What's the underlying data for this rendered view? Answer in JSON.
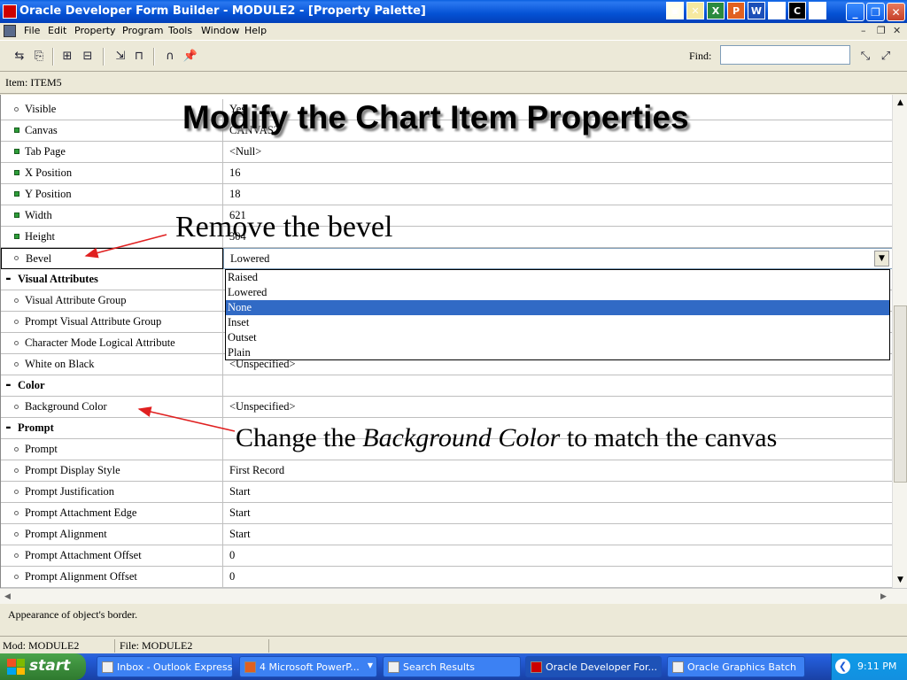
{
  "window": {
    "title": "Oracle Developer Form Builder - MODULE2 - [Property Palette]",
    "min_glyph": "_",
    "max_glyph": "❐",
    "close_glyph": "✕"
  },
  "menubar": {
    "items": [
      "File",
      "Edit",
      "Property",
      "Program",
      "Tools",
      "Window",
      "Help"
    ],
    "mdi": [
      "–",
      "❐",
      "✕"
    ]
  },
  "toolbar": {
    "find_label": "Find:",
    "find_value": ""
  },
  "context": {
    "item_label": "Item: ITEM5"
  },
  "properties": [
    {
      "name": "Visible",
      "value": "Yes",
      "marker": "default"
    },
    {
      "name": "Canvas",
      "value": "CANVAS2",
      "marker": "modified"
    },
    {
      "name": "Tab Page",
      "value": "<Null>",
      "marker": "modified"
    },
    {
      "name": "X Position",
      "value": "16",
      "marker": "modified"
    },
    {
      "name": "Y Position",
      "value": "18",
      "marker": "modified"
    },
    {
      "name": "Width",
      "value": "621",
      "marker": "modified"
    },
    {
      "name": "Height",
      "value": "304",
      "marker": "modified"
    },
    {
      "name": "Bevel",
      "value": "Lowered",
      "marker": "default"
    },
    {
      "name": "Visual Attributes",
      "value": "",
      "marker": "section"
    },
    {
      "name": "Visual Attribute Group",
      "value": "",
      "marker": "default"
    },
    {
      "name": "Prompt Visual Attribute Group",
      "value": "",
      "marker": "default"
    },
    {
      "name": "Character Mode Logical Attribute",
      "value": "",
      "marker": "default"
    },
    {
      "name": "White on Black",
      "value": "<Unspecified>",
      "marker": "default"
    },
    {
      "name": "Color",
      "value": "",
      "marker": "section"
    },
    {
      "name": "Background Color",
      "value": "<Unspecified>",
      "marker": "default"
    },
    {
      "name": "Prompt",
      "value": "",
      "marker": "section"
    },
    {
      "name": "Prompt",
      "value": "",
      "marker": "default"
    },
    {
      "name": "Prompt Display Style",
      "value": "First Record",
      "marker": "default"
    },
    {
      "name": "Prompt Justification",
      "value": "Start",
      "marker": "default"
    },
    {
      "name": "Prompt Attachment Edge",
      "value": "Start",
      "marker": "default"
    },
    {
      "name": "Prompt Alignment",
      "value": "Start",
      "marker": "default"
    },
    {
      "name": "Prompt Attachment Offset",
      "value": "0",
      "marker": "default"
    },
    {
      "name": "Prompt Alignment Offset",
      "value": "0",
      "marker": "default"
    }
  ],
  "bevel_dropdown": {
    "options": [
      "Raised",
      "Lowered",
      "None",
      "Inset",
      "Outset",
      "Plain"
    ],
    "highlighted": "None",
    "arrow": "▼"
  },
  "scroll": {
    "up": "▲",
    "down": "▼",
    "left": "◀",
    "right": "▶"
  },
  "hint": "Appearance of object's border.",
  "status": {
    "mod": "Mod: MODULE2",
    "file": "File: MODULE2"
  },
  "overlay": {
    "title": "Modify the Chart Item Properties",
    "note_bevel": "Remove the bevel",
    "note_color_pre": "Change the ",
    "note_color_em": "Background Color",
    "note_color_post": " to match the canvas"
  },
  "taskbar": {
    "start": "start",
    "tasks": [
      {
        "label": "Inbox - Outlook Express",
        "active": false
      },
      {
        "label": "4 Microsoft PowerP...",
        "active": false
      },
      {
        "label": "Search Results",
        "active": false
      },
      {
        "label": "Oracle Developer For...",
        "active": true
      },
      {
        "label": "Oracle Graphics Batch",
        "active": false
      }
    ],
    "clock": "9:11 PM",
    "tray_arrow": "❮"
  },
  "colors": {
    "title_bar": "#0451d4",
    "selection": "#316ac5",
    "modified_marker": "#2e9e3a",
    "annotation_arrow": "#e02020"
  }
}
